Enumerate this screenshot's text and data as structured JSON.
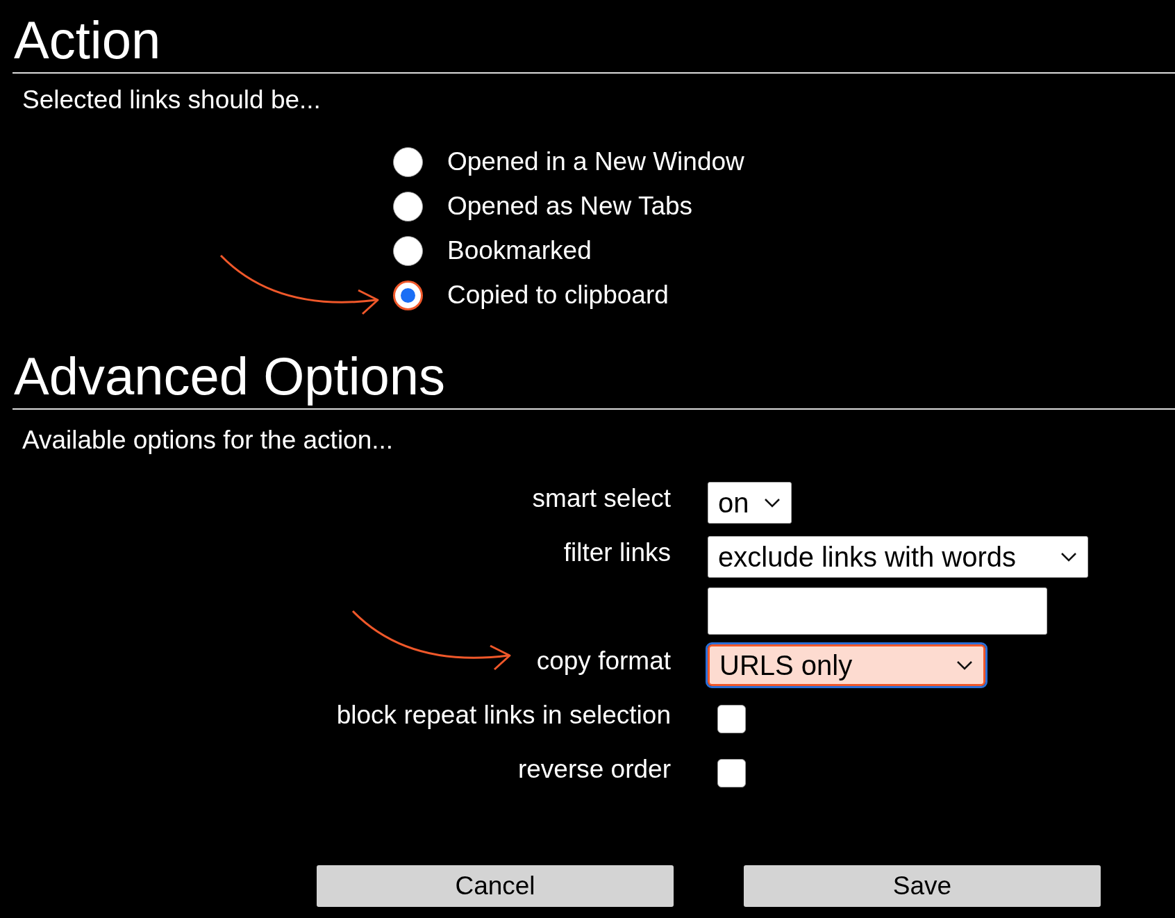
{
  "action": {
    "heading": "Action",
    "subtitle": "Selected links should be...",
    "options": [
      {
        "label": "Opened in a New Window",
        "selected": false
      },
      {
        "label": "Opened as New Tabs",
        "selected": false
      },
      {
        "label": "Bookmarked",
        "selected": false
      },
      {
        "label": "Copied to clipboard",
        "selected": true
      }
    ]
  },
  "advanced": {
    "heading": "Advanced Options",
    "subtitle": "Available options for the action...",
    "rows": [
      {
        "kind": "select",
        "label": "smart select",
        "value": "on",
        "highlighted": false
      },
      {
        "kind": "select",
        "label": "filter links",
        "value": "exclude links with words",
        "highlighted": false
      },
      {
        "kind": "text",
        "label": "",
        "value": ""
      },
      {
        "kind": "select",
        "label": "copy format",
        "value": "URLS only",
        "highlighted": true
      },
      {
        "kind": "checkbox",
        "label": "block repeat links in selection",
        "checked": false
      },
      {
        "kind": "checkbox",
        "label": "reverse order",
        "checked": false
      }
    ]
  },
  "buttons": [
    "Cancel",
    "Save"
  ]
}
